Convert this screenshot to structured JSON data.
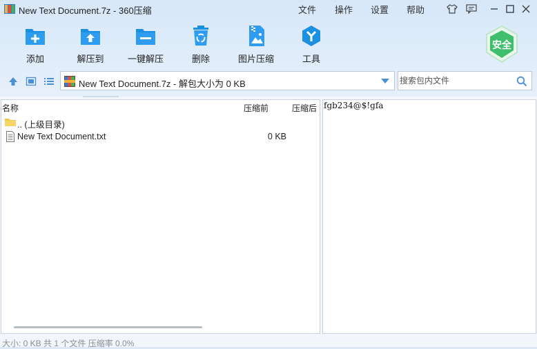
{
  "window": {
    "title": "New Text Document.7z - 360压缩",
    "menu": [
      "文件",
      "操作",
      "设置",
      "帮助"
    ]
  },
  "toolbar": {
    "buttons": [
      {
        "label": "添加",
        "icon": "add-folder-icon"
      },
      {
        "label": "解压到",
        "icon": "extract-to-icon"
      },
      {
        "label": "一键解压",
        "icon": "one-click-extract-icon"
      },
      {
        "label": "删除",
        "icon": "recycle-icon"
      },
      {
        "label": "图片压缩",
        "icon": "image-compress-icon"
      },
      {
        "label": "工具",
        "icon": "tools-icon"
      }
    ],
    "safe_label": "安全"
  },
  "pathbar": {
    "path_text": "New Text Document.7z - 解包大小为 0 KB",
    "search_placeholder": "搜索包内文件"
  },
  "filelist": {
    "columns": {
      "name": "名称",
      "before": "压缩前",
      "after": "压缩后"
    },
    "rows": [
      {
        "name": ".. (上级目录)",
        "size": "",
        "icon": "folder-icon"
      },
      {
        "name": "New Text Document.txt",
        "size": "0 KB",
        "icon": "text-file-icon"
      }
    ]
  },
  "preview": {
    "content": "fgb234@$!gfa"
  },
  "status": {
    "text": "大小: 0 KB 共 1 个文件 压缩率 0.0%"
  },
  "colors": {
    "accent": "#1b8fe0",
    "safe_green": "#3fbf6e"
  }
}
